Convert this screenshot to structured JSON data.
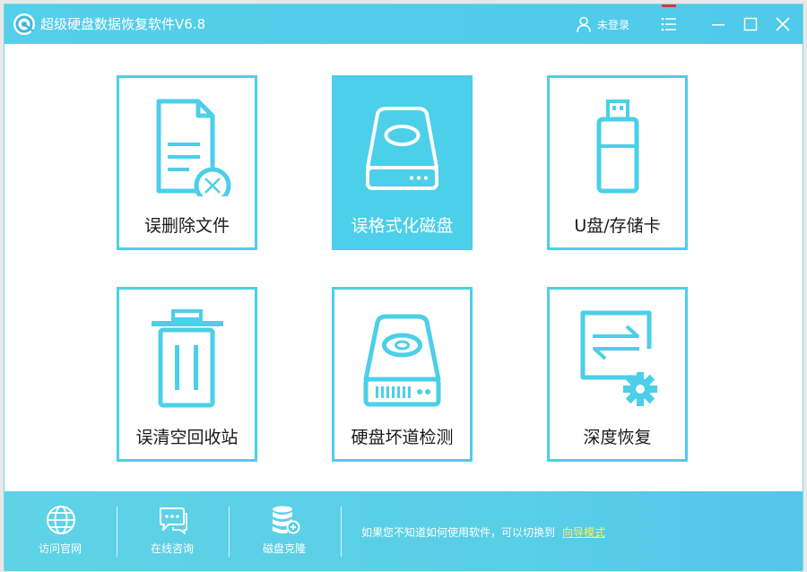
{
  "app": {
    "title": "超级硬盘数据恢复软件V6.8"
  },
  "header": {
    "user_label": "未登录"
  },
  "colors": {
    "accent": "#4ccfe8",
    "titlebar": "#53cfe9",
    "link": "#fff34a",
    "menu_marker": "#e3342f"
  },
  "tiles": [
    {
      "label": "误删除文件",
      "icon": "deleted-file-icon",
      "active": false
    },
    {
      "label": "误格式化磁盘",
      "icon": "hard-drive-icon",
      "active": true
    },
    {
      "label": "U盘/存储卡",
      "icon": "usb-drive-icon",
      "active": false
    },
    {
      "label": "误清空回收站",
      "icon": "trash-icon",
      "active": false
    },
    {
      "label": "硬盘坏道检测",
      "icon": "disk-scan-icon",
      "active": false
    },
    {
      "label": "深度恢复",
      "icon": "deep-recovery-icon",
      "active": false
    }
  ],
  "footer": {
    "items": [
      {
        "label": "访问官网",
        "icon": "globe-icon"
      },
      {
        "label": "在线咨询",
        "icon": "chat-icon"
      },
      {
        "label": "磁盘克隆",
        "icon": "database-clone-icon"
      }
    ],
    "hint_text": "如果您不知道如何使用软件，可以切换到",
    "hint_link": "向导模式"
  }
}
